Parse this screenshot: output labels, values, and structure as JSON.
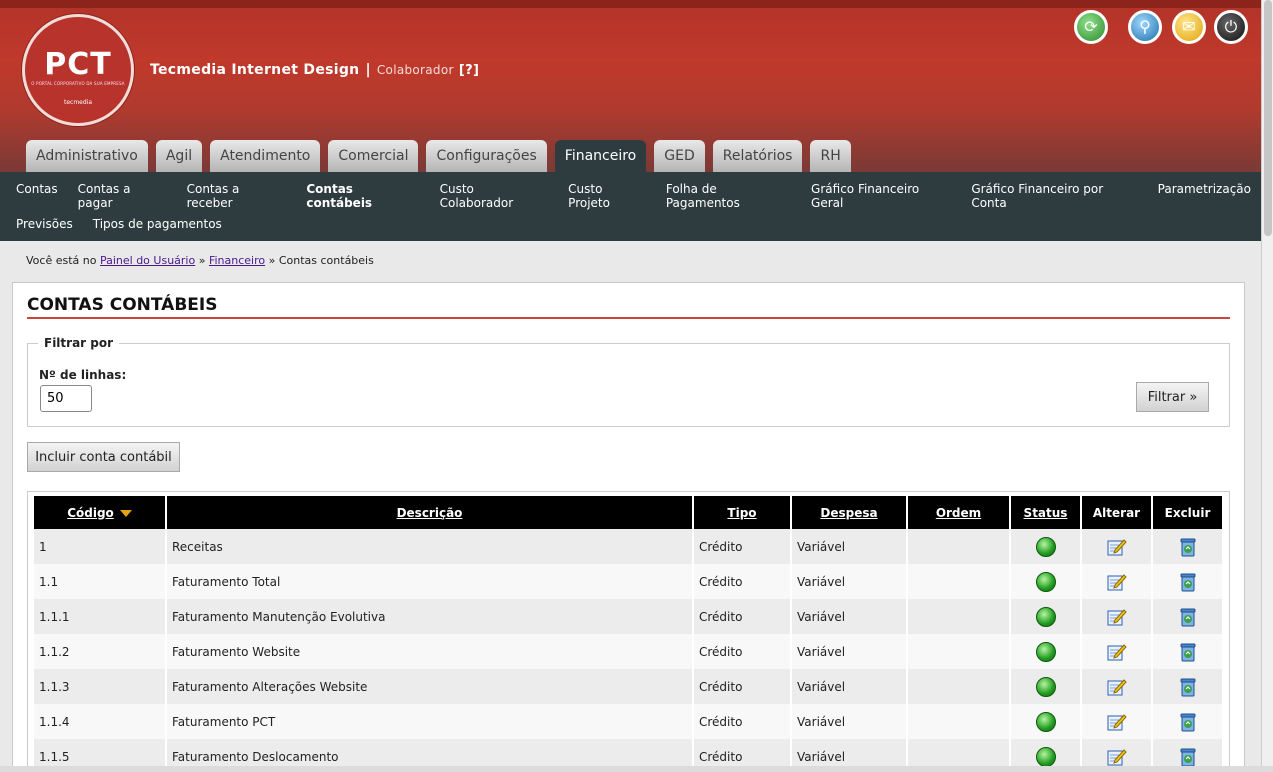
{
  "header": {
    "logo_text": "PCT",
    "logo_tagline": "O PORTAL CORPORATIVO DA SUA EMPRESA",
    "logo_brand": "tecmedia",
    "company": "Tecmedia Internet Design",
    "separator": "|",
    "role": "Colaborador",
    "help": "[?]",
    "icons": [
      "refresh-icon",
      "search-icon",
      "messages-icon",
      "power-icon"
    ]
  },
  "tabs": [
    {
      "label": "Administrativo",
      "active": false
    },
    {
      "label": "Agil",
      "active": false
    },
    {
      "label": "Atendimento",
      "active": false
    },
    {
      "label": "Comercial",
      "active": false
    },
    {
      "label": "Configurações",
      "active": false
    },
    {
      "label": "Financeiro",
      "active": true
    },
    {
      "label": "GED",
      "active": false
    },
    {
      "label": "Relatórios",
      "active": false
    },
    {
      "label": "RH",
      "active": false
    }
  ],
  "subnav": {
    "row1": [
      "Contas",
      "Contas a pagar",
      "Contas a receber",
      "Contas contábeis",
      "Custo Colaborador",
      "Custo Projeto",
      "Folha de Pagamentos",
      "Gráfico Financeiro Geral",
      "Gráfico Financeiro por Conta",
      "Parametrização"
    ],
    "row2": [
      "Previsões",
      "Tipos de pagamentos"
    ],
    "active": "Contas contábeis"
  },
  "breadcrumb": {
    "prefix": "Você está no",
    "link1": "Painel do Usuário",
    "sep": "»",
    "link2": "Financeiro",
    "current": "Contas contábeis"
  },
  "page": {
    "title": "CONTAS CONTÁBEIS",
    "filter_legend": "Filtrar por",
    "rows_label": "Nº de linhas:",
    "rows_value": "50",
    "filter_button": "Filtrar »",
    "add_button": "Incluir conta contábil"
  },
  "table": {
    "headers": [
      "Código",
      "Descrição",
      "Tipo",
      "Despesa",
      "Ordem",
      "Status",
      "Alterar",
      "Excluir"
    ],
    "rows": [
      {
        "codigo": "1",
        "descricao": "Receitas",
        "tipo": "Crédito",
        "despesa": "Variável",
        "ordem": ""
      },
      {
        "codigo": "1.1",
        "descricao": "Faturamento Total",
        "tipo": "Crédito",
        "despesa": "Variável",
        "ordem": ""
      },
      {
        "codigo": "1.1.1",
        "descricao": "Faturamento Manutenção Evolutiva",
        "tipo": "Crédito",
        "despesa": "Variável",
        "ordem": ""
      },
      {
        "codigo": "1.1.2",
        "descricao": "Faturamento Website",
        "tipo": "Crédito",
        "despesa": "Variável",
        "ordem": ""
      },
      {
        "codigo": "1.1.3",
        "descricao": "Faturamento Alterações Website",
        "tipo": "Crédito",
        "despesa": "Variável",
        "ordem": ""
      },
      {
        "codigo": "1.1.4",
        "descricao": "Faturamento PCT",
        "tipo": "Crédito",
        "despesa": "Variável",
        "ordem": ""
      },
      {
        "codigo": "1.1.5",
        "descricao": "Faturamento Deslocamento",
        "tipo": "Crédito",
        "despesa": "Variável",
        "ordem": ""
      }
    ]
  },
  "colors": {
    "header_red": "#c0392b",
    "nav_dark": "#2e3c40",
    "title_rule": "#c9463a",
    "status_green": "#1f9a1f"
  }
}
